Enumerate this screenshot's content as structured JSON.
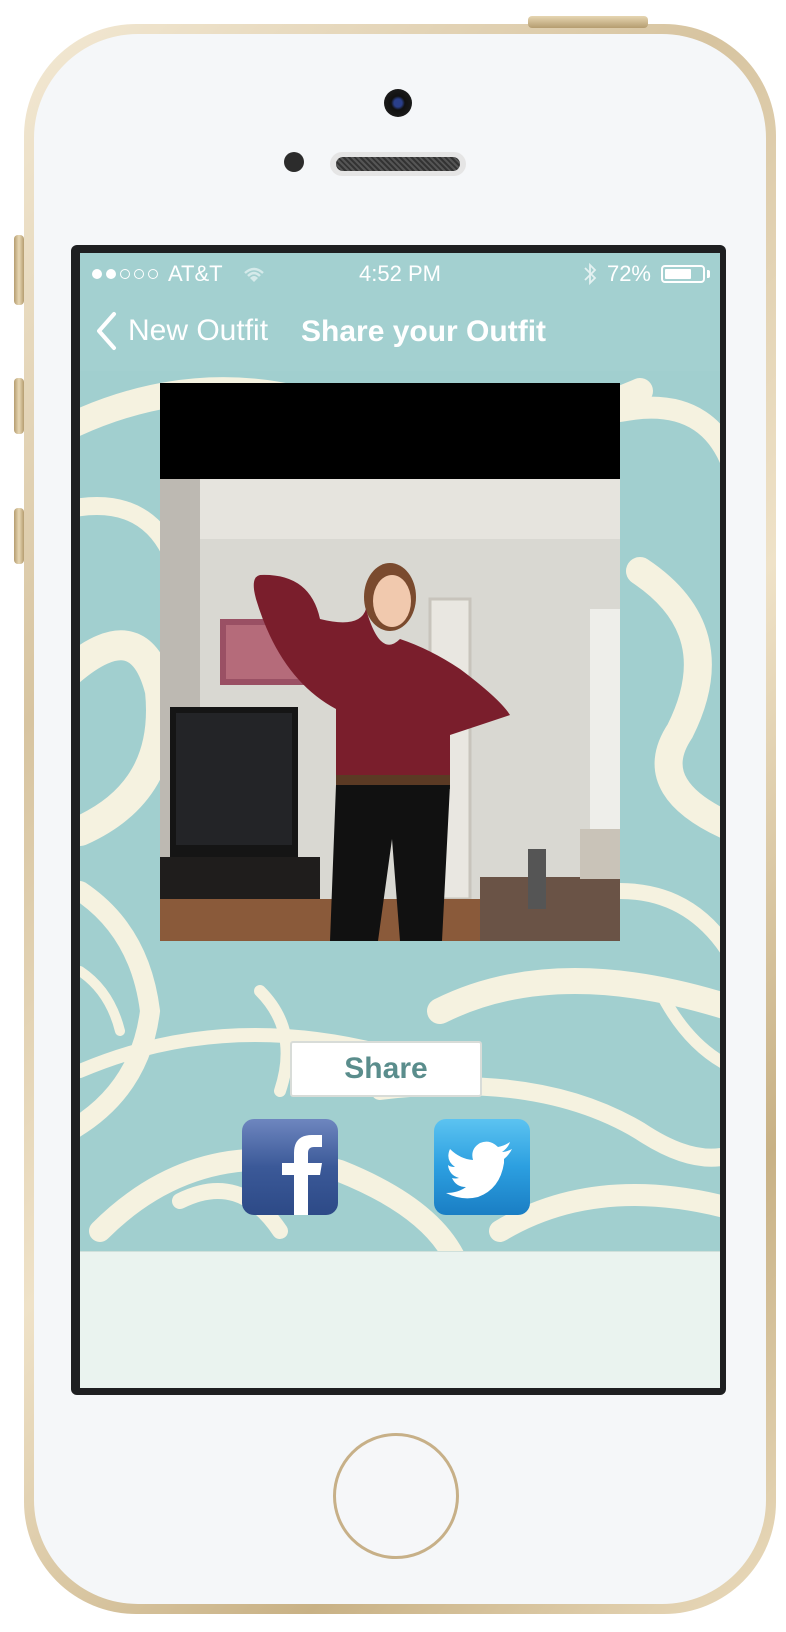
{
  "status_bar": {
    "signal_dots_filled": 2,
    "signal_dots_total": 5,
    "carrier": "AT&T",
    "time": "4:52 PM",
    "battery_percent": "72%",
    "battery_level": 0.72
  },
  "nav_bar": {
    "back_label": "New Outfit",
    "title": "Share your Outfit"
  },
  "share_button": {
    "label": "Share"
  },
  "social": [
    {
      "name": "facebook-icon"
    },
    {
      "name": "twitter-icon"
    }
  ],
  "colors": {
    "nav_bg": "#a3d0d0",
    "content_bg": "#a1cfcf",
    "swirl": "#f5f2e0",
    "share_text": "#5a8d8c",
    "facebook": "#3b5998",
    "twitter": "#2c9fe0",
    "phone_gold": "#d7c4a0"
  }
}
